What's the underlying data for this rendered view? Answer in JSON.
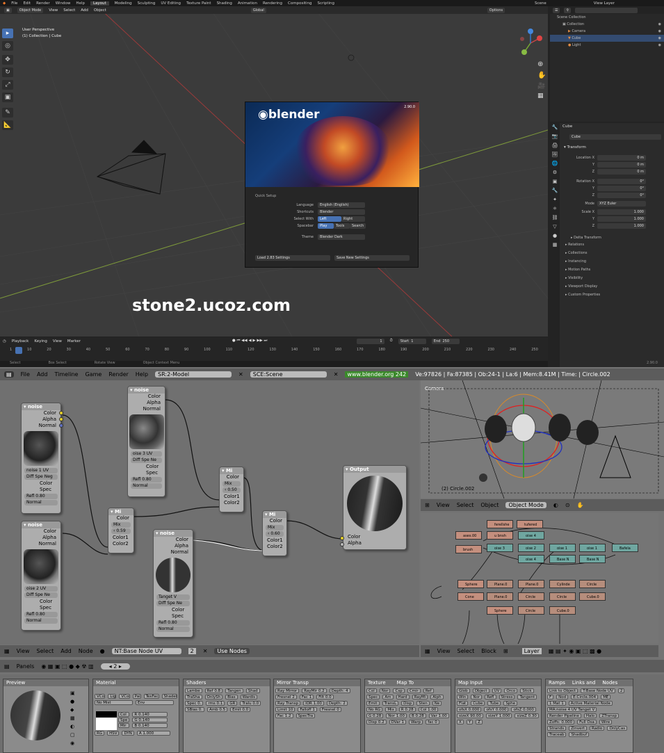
{
  "top": {
    "menu": [
      "File",
      "Edit",
      "Render",
      "Window",
      "Help"
    ],
    "workspaces": [
      "Layout",
      "Modeling",
      "Sculpting",
      "UV Editing",
      "Texture Paint",
      "Shading",
      "Animation",
      "Rendering",
      "Compositing",
      "Scripting"
    ],
    "scene_label": "Scene",
    "view_layer_label": "View Layer",
    "mode": "Object Mode",
    "header_menu": [
      "View",
      "Select",
      "Add",
      "Object"
    ],
    "orientation": "Global",
    "options": "Options",
    "viewport_title": "User Perspective",
    "viewport_sub": "(1) Collection | Cube",
    "watermark": "stone2.ucoz.com",
    "splash": {
      "logo": "blender",
      "version": "2.90.0",
      "quick_setup": "Quick Setup",
      "language_label": "Language",
      "language_value": "English (English)",
      "shortcuts_label": "Shortcuts",
      "shortcuts_value": "Blender",
      "select_label": "Select With",
      "select_left": "Left",
      "select_right": "Right",
      "spacebar_label": "Spacebar",
      "spacebar_play": "Play",
      "spacebar_tools": "Tools",
      "spacebar_search": "Search",
      "theme_label": "Theme",
      "theme_value": "Blender Dark",
      "load_btn": "Load 2.83 Settings",
      "save_btn": "Save New Settings"
    },
    "outliner": {
      "items": [
        "Scene Collection",
        "Collection",
        "Camera",
        "Cube",
        "Light"
      ]
    },
    "properties": {
      "object_name": "Cube",
      "data_name": "Cube",
      "transform": "Transform",
      "location_label": "Location X",
      "loc": [
        "0 m",
        "0 m",
        "0 m"
      ],
      "rotation_label": "Rotation X",
      "rot": [
        "0°",
        "0°",
        "0°"
      ],
      "mode_label": "Mode",
      "mode_value": "XYZ Euler",
      "scale_label": "Scale X",
      "scale": [
        "1.000",
        "1.000",
        "1.000"
      ],
      "axis_y": "Y",
      "axis_z": "Z",
      "sections": [
        "Delta Transform",
        "Relations",
        "Collections",
        "Instancing",
        "Motion Paths",
        "Visibility",
        "Viewport Display",
        "Custom Properties"
      ]
    },
    "timeline": {
      "menu": [
        "Playback",
        "Keying",
        "View",
        "Marker"
      ],
      "current": "1",
      "start_label": "Start",
      "start": "1",
      "end_label": "End",
      "end": "250",
      "ticks": [
        "1",
        "10",
        "20",
        "30",
        "40",
        "50",
        "60",
        "70",
        "80",
        "90",
        "100",
        "110",
        "120",
        "130",
        "140",
        "150",
        "160",
        "170",
        "180",
        "190",
        "200",
        "210",
        "220",
        "230",
        "240",
        "250"
      ]
    },
    "status": [
      "Select",
      "Box Select",
      "Rotate View",
      "Object Context Menu"
    ],
    "status_version": "2.90.0"
  },
  "bottom": {
    "menu": [
      "File",
      "Add",
      "Timeline",
      "Game",
      "Render",
      "Help"
    ],
    "screen": "SR:2-Model",
    "scene": "SCE:Scene",
    "url": "www.blender.org 242",
    "stats": "Ve:97826 | Fa:87385 | Ob:24-1 | La:6 | Mem:8.41M | Time: | Circle.002",
    "nodes": {
      "noise1": {
        "title": "noise",
        "outs": [
          "Color",
          "Alpha",
          "Normal"
        ],
        "tex": "noise 1 UV",
        "btns": [
          "Diff",
          "Spe",
          "Neg"
        ],
        "ins": [
          "Color",
          "Spec",
          "Refl 0.80",
          "Normal"
        ]
      },
      "noise3": {
        "title": "noise",
        "outs": [
          "Color",
          "Alpha",
          "Normal"
        ],
        "tex": "oise 3 UV",
        "btns": [
          "Diff",
          "Spe",
          "Ne"
        ],
        "ins": [
          "Color",
          "Spec",
          "Refl 0.80",
          "Normal"
        ]
      },
      "noise2": {
        "title": "noise",
        "outs": [
          "Color",
          "Alpha",
          "Normal"
        ],
        "tex": "oise 2 UV",
        "btns": [
          "Diff",
          "Spe",
          "Ne"
        ],
        "ins": [
          "Color",
          "Spec",
          "Refl 0.80",
          "Normal"
        ]
      },
      "noise4": {
        "title": "noise",
        "outs": [
          "Color",
          "Alpha",
          "Normal"
        ],
        "tex": "Tanget V",
        "btns": [
          "Diff",
          "Spe",
          "Ne"
        ],
        "ins": [
          "Color",
          "Spec",
          "Refl 0.80",
          "Normal"
        ]
      },
      "mix1": {
        "title": "Mi",
        "out": "Color",
        "mode": "Mix",
        "fac": "0.59",
        "ins": [
          "Color1",
          "Color2"
        ]
      },
      "mix2": {
        "title": "Mi",
        "out": "Color",
        "mode": "Mix",
        "fac": "0.50",
        "ins": [
          "Color1",
          "Color2"
        ]
      },
      "mix3": {
        "title": "Mi",
        "out": "Color",
        "mode": "Mix",
        "fac": "0.60",
        "ins": [
          "Color1",
          "Color2"
        ]
      },
      "output": {
        "title": "Output",
        "ins": [
          "Color",
          "Alpha"
        ]
      }
    },
    "node_toolbar": [
      "View",
      "Select",
      "Add",
      "Node"
    ],
    "node_tree": "NT:Base Node UV",
    "node_users": "2",
    "use_nodes": "Use Nodes",
    "view3d_label": "Camera",
    "view3d_obj": "(2) Circle.002",
    "view3d_toolbar": [
      "View",
      "Select",
      "Object"
    ],
    "view3d_mode": "Object Mode",
    "oops": {
      "red": [
        "ferellshe",
        "tufered",
        "ases.00",
        "u bnsh",
        "brush",
        "Sphere",
        "Cone",
        "Sphere"
      ],
      "teal": [
        "oise 4",
        "oise 3",
        "oise 2",
        "oise 4",
        "oise 1",
        "oise 1",
        "Base N",
        "Base N",
        "Bafela"
      ],
      "plain": [
        "Plane.0",
        "Plane.0",
        "Plane.0",
        "Circle",
        "Circle",
        "Circle",
        "Cylinde",
        "Circle",
        "Cube.0",
        "Cube.0"
      ]
    },
    "oops_toolbar": [
      "View",
      "Select",
      "Block"
    ],
    "oops_layer": "Layer",
    "panels_label": "Panels",
    "panels_num": "2",
    "panel_titles": [
      "Preview",
      "Material",
      "Shaders",
      "Mirror Transp",
      "Texture",
      "Map To",
      "Map Input",
      "Ramps",
      "Links and",
      "Nodes"
    ],
    "material_fields": {
      "row1": [
        "VCol",
        "Lig",
        "VCol",
        "Pai",
        "TexFace",
        "Shadele"
      ],
      "row2": [
        "No Mist",
        "Env"
      ],
      "col": "Col",
      "spe": "Spe",
      "mir": "Mir",
      "r": "R 0.140",
      "g": "G 0.140",
      "b": "B 0.140",
      "rgb": [
        "RG",
        "HSV",
        "DYN",
        "A 1.000"
      ]
    },
    "shader_fields": [
      "Lambe",
      "Ref 0.8",
      "Tangen",
      "Shad",
      "TraSha",
      "OnlySh",
      "Bias",
      "Wardis",
      "Spec 0.",
      "rms 0.1",
      "GR",
      "Tralu 0.0",
      "SBias 0.",
      "Amb 0.5",
      "Emit 0.0"
    ],
    "mirror_fields": [
      "Ray Mirror",
      "RayMir 0.2",
      "Depth: 4",
      "Fresnel 2",
      "Fac 1",
      "Filt 0.0",
      "Ray Transp",
      "IOR 1.00",
      "Depth: 2",
      "Limit 10",
      "Falloff 1",
      "Fresnel 0",
      "Fac 1.2",
      "SpecTra"
    ],
    "texture_fields": [
      "Col",
      "Nor",
      "Csp",
      "Cmir",
      "Ref",
      "Spec",
      "Am",
      "Hard",
      "RayMi",
      "Alph",
      "Emit",
      "TransL",
      "Disp",
      "Sten",
      "Ne",
      "No RG",
      "Mix",
      "R 0.28",
      "Col 1.00",
      "G 0.28",
      "Nor 1.00",
      "B 0.28",
      "Var 1.00",
      "Disp 0.2",
      "DVar 1",
      "Warp",
      "fac 0"
    ],
    "mapinput_fields": [
      "Glob",
      "Object",
      "UV",
      "Orco",
      "Stick",
      "Win",
      "Nor",
      "Refl",
      "Stress",
      "Tangent",
      "Flat",
      "Cube",
      "Tube",
      "Sphe",
      "ofsX 0.000",
      "ofsY 0.000",
      "ofsZ 0.000",
      "sizeX 90.00",
      "sizeY 1.000",
      "sizeZ 0.30",
      "X",
      "Y",
      "Z"
    ],
    "links_fields": [
      "Link to Object",
      "T:Base Node UV",
      "2",
      "F",
      "Nod",
      "E:Circle.004",
      "ME",
      "1 Mat 1",
      "Active Material Node",
      "MA:noise 4 UV Tanget V",
      "Render Pipeline",
      "Halo",
      "ZTransp",
      "Zoffs: 0.000",
      "Full Osa",
      "Wire",
      "Strands",
      "Zinvert",
      "Radio",
      "OnlyCas",
      "Traceab",
      "Shadbuf"
    ]
  }
}
